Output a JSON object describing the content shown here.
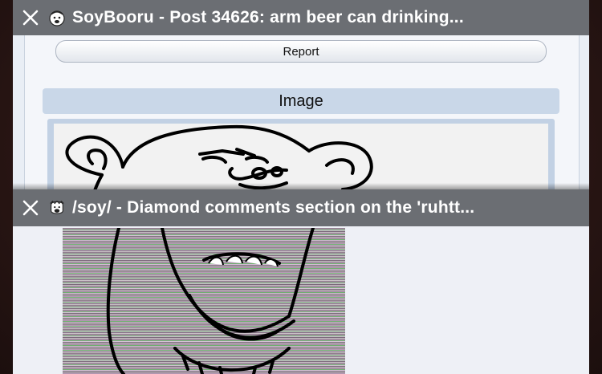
{
  "tabs": [
    {
      "title": "SoyBooru - Post 34626: arm beer can drinking...",
      "favicon": "soyjak-face-icon",
      "page": {
        "report_label": "Report",
        "section_label": "Image"
      }
    },
    {
      "title": "/soy/ - Diamond comments section on the 'ruhtt...",
      "favicon": "soyjak-face-icon"
    }
  ],
  "colors": {
    "titlebar": "#6b6e73",
    "section_bar": "#c9d7e8",
    "page_bg": "#f4f6fa"
  }
}
